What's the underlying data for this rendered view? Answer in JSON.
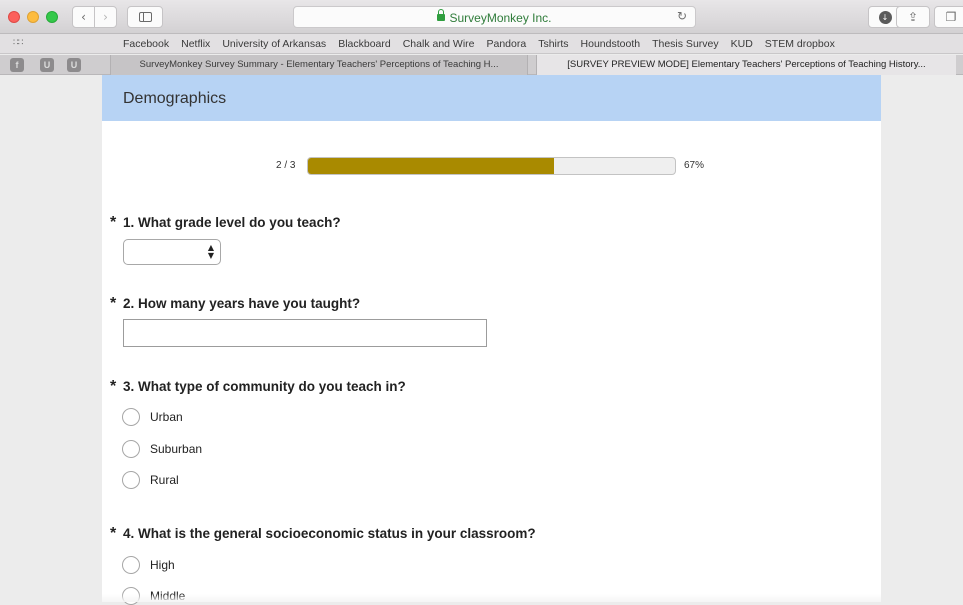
{
  "browser": {
    "url_text": "SurveyMonkey Inc.",
    "favorites": [
      "Facebook",
      "Netflix",
      "University of Arkansas",
      "Blackboard",
      "Chalk and Wire",
      "Pandora",
      "Tshirts",
      "Houndstooth",
      "Thesis Survey",
      "KUD",
      "STEM dropbox"
    ],
    "pinned_tabs": [
      {
        "letter": "f",
        "icon": "facebook-icon"
      },
      {
        "letter": "U",
        "icon": "arkansas-u-icon"
      },
      {
        "letter": "U",
        "icon": "arkansas-u-icon"
      }
    ],
    "tabs": [
      {
        "title": "SurveyMonkey Survey Summary - Elementary Teachers' Perceptions of Teaching H..."
      },
      {
        "title": "[SURVEY PREVIEW MODE] Elementary Teachers' Perceptions of Teaching History..."
      }
    ]
  },
  "survey": {
    "page_title": "Demographics",
    "progress": {
      "label": "2 / 3",
      "percent_text": "67%",
      "fraction": 0.67
    },
    "questions": [
      {
        "number": "1.",
        "required_marker": "*",
        "text": "What grade level do you teach?",
        "type": "select",
        "selected_value": ""
      },
      {
        "number": "2.",
        "required_marker": "*",
        "text": "How many years have you taught?",
        "type": "text",
        "value": ""
      },
      {
        "number": "3.",
        "required_marker": "*",
        "text": "What type of community do you teach in?",
        "type": "radio",
        "options": [
          "Urban",
          "Suburban",
          "Rural"
        ]
      },
      {
        "number": "4.",
        "required_marker": "*",
        "text": "What is the general socioeconomic status in your classroom?",
        "type": "radio",
        "options": [
          "High",
          "Middle"
        ]
      }
    ]
  },
  "colors": {
    "header_bg": "#b7d3f4",
    "progress_fill": "#a98a00",
    "lock_green": "#2f9e3f"
  }
}
